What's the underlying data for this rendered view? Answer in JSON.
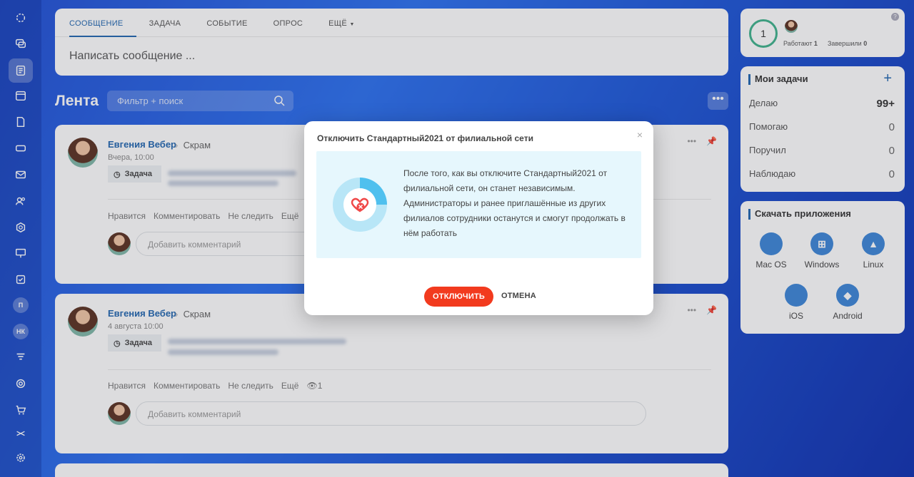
{
  "composer": {
    "tabs": [
      "СООБЩЕНИЕ",
      "ЗАДАЧА",
      "СОБЫТИЕ",
      "ОПРОС",
      "ЕЩЁ"
    ],
    "placeholder": "Написать сообщение ..."
  },
  "feed": {
    "title": "Лента",
    "filter_placeholder": "Фильтр + поиск",
    "more": "•••"
  },
  "posts": [
    {
      "author": "Евгения Вебер",
      "crumb": "Скрам",
      "time": "Вчера, 10:00",
      "badge": "Задача",
      "actions": [
        "Нравится",
        "Комментировать",
        "Не следить",
        "Ещё"
      ],
      "comment_placeholder": "Добавить комментарий"
    },
    {
      "author": "Евгения Вебер",
      "crumb": "Скрам",
      "time": "4 августа 10:00",
      "badge": "Задача",
      "actions": [
        "Нравится",
        "Комментировать",
        "Не следить",
        "Ещё"
      ],
      "views": "1",
      "comment_placeholder": "Добавить комментарий"
    }
  ],
  "timer": {
    "count": "1",
    "working_label": "Работают",
    "working_count": "1",
    "finished_label": "Завершили",
    "finished_count": "0",
    "help": "?"
  },
  "tasks": {
    "title": "Мои задачи",
    "add": "+",
    "rows": [
      {
        "label": "Делаю",
        "count": "99+"
      },
      {
        "label": "Помогаю",
        "count": "0"
      },
      {
        "label": "Поручил",
        "count": "0"
      },
      {
        "label": "Наблюдаю",
        "count": "0"
      }
    ]
  },
  "apps": {
    "title": "Скачать приложения",
    "items": [
      "Mac OS",
      "Windows",
      "Linux",
      "iOS",
      "Android"
    ]
  },
  "sidebar": {
    "initials": [
      "П",
      "НК"
    ]
  },
  "modal": {
    "title": "Отключить Стандартный2021 от филиальной сети",
    "close": "×",
    "text": "После того, как вы отключите Стандартный2021 от филиальной сети, он станет независимым. Администраторы и ранее приглашённые из других филиалов сотрудники останутся и смогут продолжать в нём работать",
    "confirm": "ОТКЛЮЧИТЬ",
    "cancel": "ОТМЕНА"
  },
  "colors": {
    "accent": "#2066b0",
    "danger": "#f23a1e",
    "info_bg": "#e6f7fd",
    "timer_ring": "#3db28c"
  }
}
